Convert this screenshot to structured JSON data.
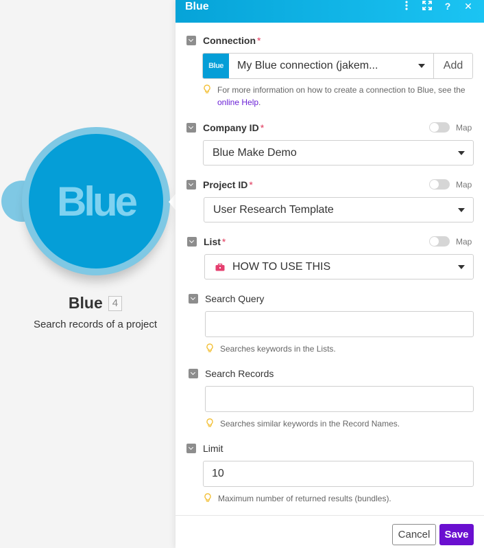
{
  "module": {
    "logo_text": "Blue",
    "name": "Blue",
    "badge": "4",
    "description": "Search records of a project"
  },
  "panel": {
    "title": "Blue",
    "header_icons": [
      "more-vertical-icon",
      "expand-icon",
      "help-icon",
      "close-icon"
    ]
  },
  "connection": {
    "label": "Connection",
    "required": "*",
    "logo_text": "Blue",
    "value": "My Blue connection (jakem...",
    "add_label": "Add",
    "hint_before": "For more information on how to create a connection to Blue, see the",
    "hint_link": "online Help",
    "hint_after": "."
  },
  "company": {
    "label": "Company ID",
    "required": "*",
    "map_label": "Map",
    "value": "Blue Make Demo"
  },
  "project": {
    "label": "Project ID",
    "required": "*",
    "map_label": "Map",
    "value": "User Research Template"
  },
  "list": {
    "label": "List",
    "required": "*",
    "map_label": "Map",
    "value": "HOW TO USE THIS"
  },
  "search_query": {
    "label": "Search Query",
    "value": "",
    "hint": "Searches keywords in the Lists."
  },
  "search_records": {
    "label": "Search Records",
    "value": "",
    "hint": "Searches similar keywords in the Record Names."
  },
  "limit": {
    "label": "Limit",
    "value": "10",
    "hint": "Maximum number of returned results (bundles)."
  },
  "footer": {
    "cancel_label": "Cancel",
    "save_label": "Save"
  },
  "colors": {
    "brand_blue": "#059ed7",
    "header_gradient_end": "#1bc4f3",
    "save_purple": "#6a0fd0",
    "required_red": "#e0375a",
    "link_purple": "#6b21d6"
  }
}
